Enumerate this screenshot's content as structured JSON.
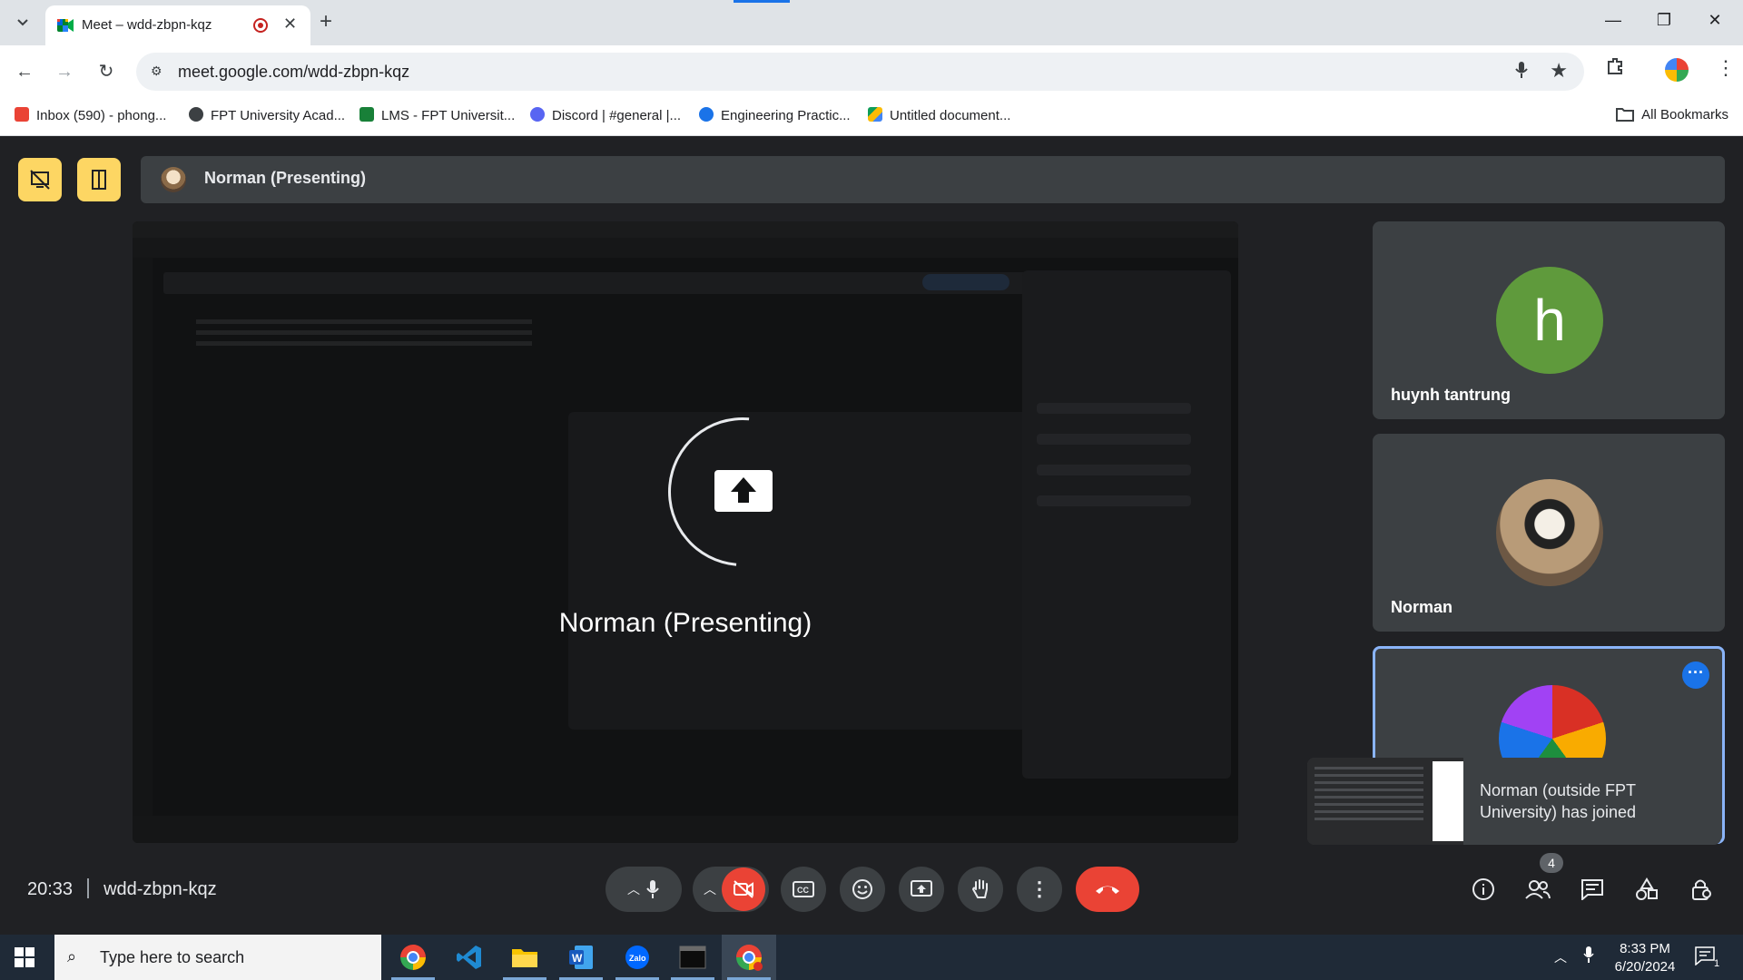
{
  "browser": {
    "tab_title": "Meet – wdd-zbpn-kqz",
    "url": "meet.google.com/wdd-zbpn-kqz",
    "bookmarks": [
      {
        "label": "Inbox (590) - phong...",
        "color": "#ea4335"
      },
      {
        "label": "FPT University Acad...",
        "color": "#3c4043"
      },
      {
        "label": "LMS - FPT Universit...",
        "color": "#188038"
      },
      {
        "label": "Discord | #general |...",
        "color": "#5865f2"
      },
      {
        "label": "Engineering Practic...",
        "color": "#1a73e8"
      },
      {
        "label": "Untitled document...",
        "color": "#fbbc04"
      }
    ],
    "all_bookmarks_label": "All Bookmarks"
  },
  "meet": {
    "presenter_bar_name": "Norman (Presenting)",
    "stage_label": "Norman (Presenting)",
    "participants": [
      {
        "name": "huynh tantrung",
        "initial": "h",
        "avatar_color": "#5f9a3c"
      },
      {
        "name": "Norman",
        "initial": "",
        "avatar_color": "#8a6a48"
      },
      {
        "name": "",
        "initial": "",
        "avatar_color": "#d93025"
      }
    ],
    "toast_message": "Norman (outside FPT University) has joined",
    "clock": "20:33",
    "meeting_code": "wdd-zbpn-kqz",
    "people_count": "4",
    "accent_color": "#fdd663",
    "end_call_color": "#ea4335"
  },
  "taskbar": {
    "search_placeholder": "Type here to search",
    "time": "8:33 PM",
    "date": "6/20/2024",
    "notification_count": "1"
  }
}
